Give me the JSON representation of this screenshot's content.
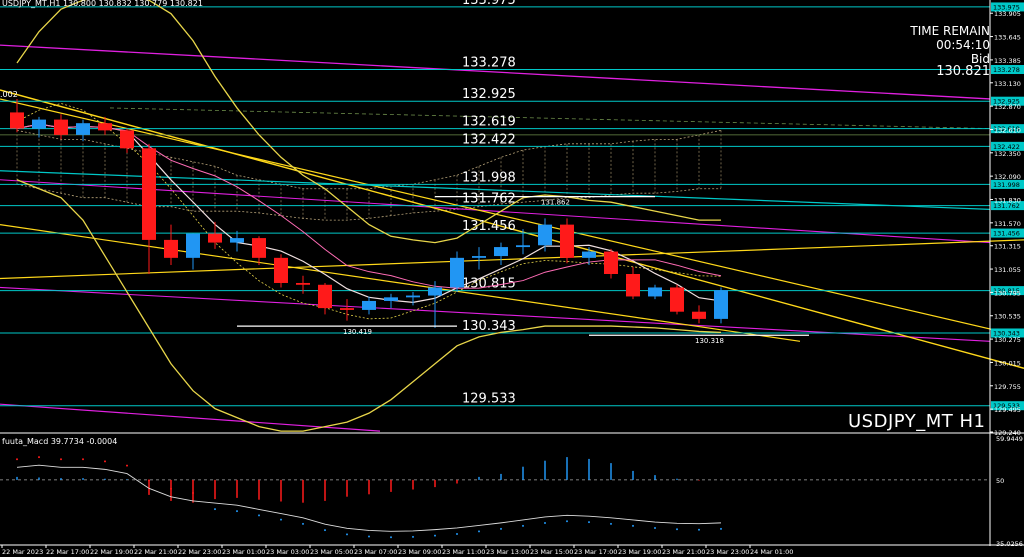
{
  "window": {
    "symbol_header": "USDJPY_MT,H1  130.800 130.832 130.779 130.821",
    "symbol_watermark": "USDJPY_MT H1",
    "left_edge_label": ".002"
  },
  "time_remain": {
    "label": "TIME REMAIN",
    "value": "00:54:10",
    "bid_label": "Bid",
    "bid_value": "130.821"
  },
  "indicator": {
    "title": "fuuta_Macd 39.7734  -0.0004",
    "scale": [
      "59.9449",
      "50",
      "35.0256"
    ],
    "levels": [
      50
    ]
  },
  "colors": {
    "bull": "#2196f3",
    "bear": "#ff1a1a",
    "hline": "#00c8c8",
    "label_bg": "#00c8c8",
    "bollinger": "#e8d64a",
    "magenta": "#e020e0",
    "sma": "#f0e0e0",
    "grid": "#ffffff"
  },
  "chart_data": {
    "type": "candlestick",
    "price_axis": [
      "133.905",
      "133.645",
      "133.385",
      "133.130",
      "132.870",
      "132.610",
      "132.350",
      "132.090",
      "131.830",
      "131.570",
      "131.315",
      "131.055",
      "130.795",
      "130.535",
      "130.275",
      "130.015",
      "129.755",
      "129.495",
      "129.240"
    ],
    "ylim": [
      129.24,
      134.03
    ],
    "time_axis": [
      "22 Mar 2023",
      "22 Mar 17:00",
      "22 Mar 19:00",
      "22 Mar 21:00",
      "22 Mar 23:00",
      "23 Mar 01:00",
      "23 Mar 03:00",
      "23 Mar 05:00",
      "23 Mar 07:00",
      "23 Mar 09:00",
      "23 Mar 11:00",
      "23 Mar 13:00",
      "23 Mar 15:00",
      "23 Mar 17:00",
      "23 Mar 19:00",
      "23 Mar 21:00",
      "23 Mar 23:00",
      "24 Mar 01:00"
    ],
    "levels": [
      {
        "value": 133.975,
        "label": "133.975"
      },
      {
        "value": 133.278,
        "label": "133.278"
      },
      {
        "value": 132.925,
        "label": "132.925"
      },
      {
        "value": 132.619,
        "label": "132.619"
      },
      {
        "value": 132.422,
        "label": "132.422"
      },
      {
        "value": 131.998,
        "label": "131.998"
      },
      {
        "value": 131.762,
        "label": "131.762"
      },
      {
        "value": 131.456,
        "label": "131.456"
      },
      {
        "value": 130.815,
        "label": "130.815"
      },
      {
        "value": 130.343,
        "label": "130.343"
      },
      {
        "value": 129.533,
        "label": "129.533"
      }
    ],
    "point_labels": [
      {
        "text": "130.419",
        "value": 130.419,
        "bar": 15
      },
      {
        "text": "131.862",
        "value": 131.862,
        "bar": 24
      },
      {
        "text": "130.318",
        "value": 130.318,
        "bar": 31
      }
    ],
    "candles": [
      {
        "o": 132.8,
        "h": 132.95,
        "l": 132.58,
        "c": 132.62
      },
      {
        "o": 132.62,
        "h": 132.75,
        "l": 132.52,
        "c": 132.72
      },
      {
        "o": 132.72,
        "h": 132.78,
        "l": 132.5,
        "c": 132.55
      },
      {
        "o": 132.55,
        "h": 132.72,
        "l": 132.48,
        "c": 132.68
      },
      {
        "o": 132.68,
        "h": 132.75,
        "l": 132.55,
        "c": 132.6
      },
      {
        "o": 132.6,
        "h": 132.62,
        "l": 132.35,
        "c": 132.4
      },
      {
        "o": 132.4,
        "h": 132.45,
        "l": 131.0,
        "c": 131.38
      },
      {
        "o": 131.38,
        "h": 131.55,
        "l": 131.1,
        "c": 131.18
      },
      {
        "o": 131.18,
        "h": 131.45,
        "l": 131.05,
        "c": 131.45
      },
      {
        "o": 131.45,
        "h": 131.58,
        "l": 131.28,
        "c": 131.35
      },
      {
        "o": 131.35,
        "h": 131.48,
        "l": 131.25,
        "c": 131.4
      },
      {
        "o": 131.4,
        "h": 131.42,
        "l": 131.1,
        "c": 131.18
      },
      {
        "o": 131.18,
        "h": 131.22,
        "l": 130.85,
        "c": 130.9
      },
      {
        "o": 130.9,
        "h": 130.98,
        "l": 130.78,
        "c": 130.88
      },
      {
        "o": 130.88,
        "h": 130.9,
        "l": 130.55,
        "c": 130.62
      },
      {
        "o": 130.62,
        "h": 130.72,
        "l": 130.48,
        "c": 130.6
      },
      {
        "o": 130.6,
        "h": 130.75,
        "l": 130.55,
        "c": 130.7
      },
      {
        "o": 130.7,
        "h": 130.78,
        "l": 130.62,
        "c": 130.74
      },
      {
        "o": 130.74,
        "h": 130.8,
        "l": 130.65,
        "c": 130.76
      },
      {
        "o": 130.76,
        "h": 130.92,
        "l": 130.4,
        "c": 130.85
      },
      {
        "o": 130.85,
        "h": 131.25,
        "l": 130.8,
        "c": 131.18
      },
      {
        "o": 131.18,
        "h": 131.3,
        "l": 131.05,
        "c": 131.2
      },
      {
        "o": 131.2,
        "h": 131.35,
        "l": 131.1,
        "c": 131.3
      },
      {
        "o": 131.3,
        "h": 131.5,
        "l": 131.22,
        "c": 131.32
      },
      {
        "o": 131.32,
        "h": 131.62,
        "l": 131.25,
        "c": 131.55
      },
      {
        "o": 131.55,
        "h": 131.62,
        "l": 131.12,
        "c": 131.18
      },
      {
        "o": 131.18,
        "h": 131.3,
        "l": 131.1,
        "c": 131.25
      },
      {
        "o": 131.25,
        "h": 131.28,
        "l": 130.95,
        "c": 131.0
      },
      {
        "o": 131.0,
        "h": 131.08,
        "l": 130.72,
        "c": 130.75
      },
      {
        "o": 130.75,
        "h": 130.88,
        "l": 130.72,
        "c": 130.85
      },
      {
        "o": 130.85,
        "h": 130.88,
        "l": 130.55,
        "c": 130.58
      },
      {
        "o": 130.58,
        "h": 130.65,
        "l": 130.45,
        "c": 130.5
      },
      {
        "o": 130.5,
        "h": 130.85,
        "l": 130.45,
        "c": 130.82
      }
    ],
    "macd_histogram": [
      0.5,
      0.4,
      0.3,
      0.3,
      0.2,
      0.1,
      -2.5,
      -3.5,
      -3.8,
      -3.2,
      -3.0,
      -3.3,
      -3.6,
      -3.8,
      -3.5,
      -2.8,
      -2.4,
      -2.0,
      -1.6,
      -1.2,
      -0.6,
      0.5,
      1.0,
      2.2,
      3.2,
      3.8,
      3.5,
      2.8,
      1.5,
      0.8,
      0.2,
      -0.1,
      0.0
    ],
    "macd_signal": [
      53,
      53.5,
      53,
      53,
      52.5,
      51.5,
      48,
      46,
      45,
      44.5,
      44,
      43,
      42,
      41,
      39.5,
      38.5,
      38,
      37.8,
      37.9,
      38.2,
      38.6,
      39.2,
      39.8,
      40.5,
      41.2,
      41.6,
      41.4,
      41,
      40.5,
      40,
      39.7,
      39.6,
      39.8
    ]
  }
}
